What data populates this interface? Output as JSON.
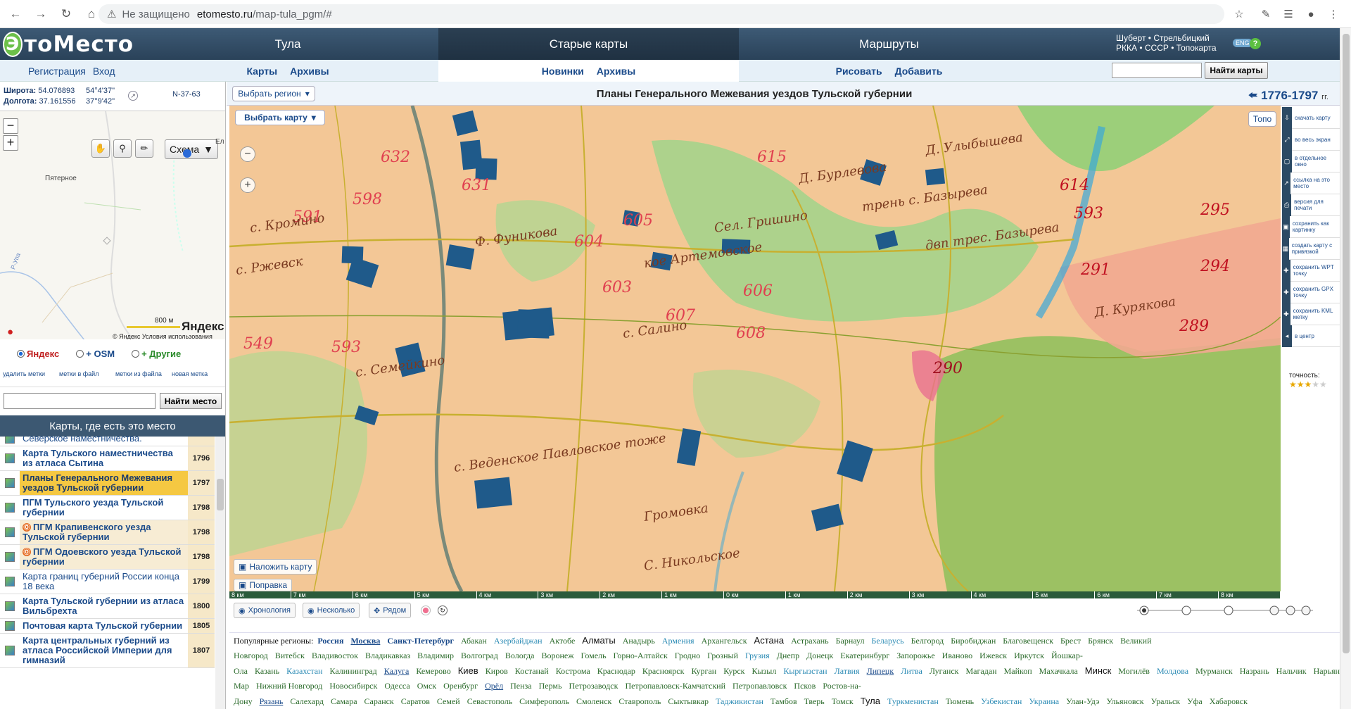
{
  "browser": {
    "security_label": "Не защищено",
    "url_domain": "etomesto.ru",
    "url_path": "/map-tula_pgm/#"
  },
  "header": {
    "logo": "ЭтоМесто",
    "sections": [
      "Тула",
      "Старые карты",
      "Маршруты"
    ],
    "right_line1": "Шуберт • Стрельбицкий",
    "right_line2": "РККА • СССР • Топокарта",
    "lang_badge": "ENG",
    "help": "?"
  },
  "subnav": {
    "auth": [
      "Регистрация",
      "Вход"
    ],
    "sec1": [
      "Карты",
      "Архивы"
    ],
    "sec2": [
      "Новинки",
      "Архивы"
    ],
    "sec3": [
      "Рисовать",
      "Добавить"
    ],
    "find_map_button": "Найти карты"
  },
  "coords": {
    "lat_label": "Широта:",
    "lat_value": "54.076893",
    "lat_dms": "54°4'37\"",
    "lon_label": "Долгота:",
    "lon_value": "37.161556",
    "lon_dms": "37°9'42\"",
    "sheet": "N-37-63"
  },
  "minimap": {
    "scheme_label": "Схема",
    "place_label": "Пятерное",
    "place_edge": "Ел",
    "road_label": "Р-Упа",
    "scale_label": "800 м",
    "yandex_logo": "Яндекс",
    "copyright": "© Яндекс",
    "terms": "Условия использования"
  },
  "providers": [
    "Яндекс",
    "+ OSM",
    "+ Другие"
  ],
  "mark_buttons": [
    "удалить метки",
    "метки в файл",
    "метки из файла",
    "новая метка"
  ],
  "find_place_button": "Найти место",
  "maps_list": {
    "header": "Карты, где есть это место",
    "rows": [
      {
        "title": "Северское наместничества.",
        "year": "",
        "style": "norm"
      },
      {
        "title": "Карта Тульского наместничества из атласа Сытина",
        "year": "1796",
        "style": "bold"
      },
      {
        "title": "Планы Генерального Межевания уездов Тульской губернии",
        "year": "1797",
        "style": "sel"
      },
      {
        "title": "ПГМ Тульского уезда Тульской губернии",
        "year": "1798",
        "style": "bold"
      },
      {
        "title": "ПГМ Крапивенского уезда Тульской губернии",
        "year": "1798",
        "style": "alt",
        "old": true
      },
      {
        "title": "ПГМ Одоевского уезда Тульской губернии",
        "year": "1798",
        "style": "alt",
        "old": true
      },
      {
        "title": "Карта границ губерний России конца 18 века",
        "year": "1799",
        "style": "norm"
      },
      {
        "title": "Карта Тульской губернии из атласа Вильбрехта",
        "year": "1800",
        "style": "bold"
      },
      {
        "title": "Почтовая карта Тульской губернии",
        "year": "1805",
        "style": "bold"
      },
      {
        "title": "Карта центральных губерний из атласа Российской Империи для гимназий",
        "year": "1807",
        "style": "bold"
      }
    ]
  },
  "map": {
    "region_button": "Выбрать регион",
    "title": "Планы Генерального Межевания уездов Тульской губернии",
    "years": "1776-1797",
    "years_suffix": "гг.",
    "choose_map_button": "Выбрать карту",
    "topo_button": "Топо",
    "overlay_button": "Наложить карту",
    "correction_button": "Поправка",
    "scale_ticks": [
      "8 км",
      "7 км",
      "6 км",
      "5 км",
      "4 км",
      "3 км",
      "2 км",
      "1 км",
      "0 км",
      "1 км",
      "2 км",
      "3 км",
      "4 км",
      "5 км",
      "6 км",
      "7 км",
      "8 км"
    ],
    "bottom_tools": [
      "Хронология",
      "Несколько",
      "Рядом"
    ],
    "labels": [
      "591",
      "593",
      "605",
      "603",
      "604",
      "606",
      "607",
      "608",
      "615",
      "614",
      "593",
      "295",
      "291",
      "294",
      "289",
      "290",
      "632",
      "631",
      "549",
      "598",
      "с. Кромино",
      "Ф. Фуникова",
      "кое Артемовское",
      "Сел. Гришино",
      "трень с. Базырева",
      "двп трес. Базырева",
      "с. Салино",
      "с. Семейкино",
      "Громовка",
      "с. Веденское Павловское тоже",
      "С. Никольское",
      "Д. Бурлевова",
      "Д. Улыбышева",
      "с. Ржевск",
      "Д. Курякова"
    ]
  },
  "right_tools": [
    "скачать карту",
    "во весь экран",
    "в отдельное окно",
    "ссылка на это место",
    "версия для печати",
    "сохранить как картинку",
    "создать карту с привязкой",
    "сохранить WPT точку",
    "сохранить GPX точку",
    "сохранить KML метку",
    "в центр"
  ],
  "accuracy_label": "точность:",
  "accuracy_stars": 3,
  "regions": {
    "label": "Популярные регионы:",
    "items": [
      {
        "n": "Россия",
        "s": "b"
      },
      {
        "n": "Москва",
        "s": "bu"
      },
      {
        "n": "Санкт-Петербург",
        "s": "b"
      },
      {
        "n": "Абакан",
        "s": "g"
      },
      {
        "n": "Азербайджан",
        "s": "t"
      },
      {
        "n": "Актобе",
        "s": "g"
      },
      {
        "n": "Алматы",
        "s": "bk"
      },
      {
        "n": "Анадырь",
        "s": "g"
      },
      {
        "n": "Армения",
        "s": "t"
      },
      {
        "n": "Архангельск",
        "s": "g"
      },
      {
        "n": "Астана",
        "s": "bk"
      },
      {
        "n": "Астрахань",
        "s": "g"
      },
      {
        "n": "Барнаул",
        "s": "g"
      },
      {
        "n": "Беларусь",
        "s": "t"
      },
      {
        "n": "Белгород",
        "s": "g"
      },
      {
        "n": "Биробиджан",
        "s": "g"
      },
      {
        "n": "Благовещенск",
        "s": "g"
      },
      {
        "n": "Брест",
        "s": "g"
      },
      {
        "n": "Брянск",
        "s": "g"
      },
      {
        "n": "Великий Новгород",
        "s": "g"
      },
      {
        "n": "Витебск",
        "s": "g"
      },
      {
        "n": "Владивосток",
        "s": "g"
      },
      {
        "n": "Владикавказ",
        "s": "g"
      },
      {
        "n": "Владимир",
        "s": "g"
      },
      {
        "n": "Волгоград",
        "s": "g"
      },
      {
        "n": "Вологда",
        "s": "g"
      },
      {
        "n": "Воронеж",
        "s": "g"
      },
      {
        "n": "Гомель",
        "s": "g"
      },
      {
        "n": "Горно-Алтайск",
        "s": "g"
      },
      {
        "n": "Гродно",
        "s": "g"
      },
      {
        "n": "Грозный",
        "s": "g"
      },
      {
        "n": "Грузия",
        "s": "t"
      },
      {
        "n": "Днепр",
        "s": "g"
      },
      {
        "n": "Донецк",
        "s": "g"
      },
      {
        "n": "Екатеринбург",
        "s": "g"
      },
      {
        "n": "Запорожье",
        "s": "g"
      },
      {
        "n": "Иваново",
        "s": "g"
      },
      {
        "n": "Ижевск",
        "s": "g"
      },
      {
        "n": "Иркутск",
        "s": "g"
      },
      {
        "n": "Йошкар-Ола",
        "s": "g"
      },
      {
        "n": "Казань",
        "s": "g"
      },
      {
        "n": "Казахстан",
        "s": "t"
      },
      {
        "n": "Калининград",
        "s": "g"
      },
      {
        "n": "Калуга",
        "s": "u"
      },
      {
        "n": "Кемерово",
        "s": "g"
      },
      {
        "n": "Киев",
        "s": "bk"
      },
      {
        "n": "Киров",
        "s": "g"
      },
      {
        "n": "Костанай",
        "s": "g"
      },
      {
        "n": "Кострома",
        "s": "g"
      },
      {
        "n": "Краснодар",
        "s": "g"
      },
      {
        "n": "Красноярск",
        "s": "g"
      },
      {
        "n": "Курган",
        "s": "g"
      },
      {
        "n": "Курск",
        "s": "g"
      },
      {
        "n": "Кызыл",
        "s": "g"
      },
      {
        "n": "Кыргызстан",
        "s": "t"
      },
      {
        "n": "Латвия",
        "s": "t"
      },
      {
        "n": "Липецк",
        "s": "u"
      },
      {
        "n": "Литва",
        "s": "t"
      },
      {
        "n": "Луганск",
        "s": "g"
      },
      {
        "n": "Магадан",
        "s": "g"
      },
      {
        "n": "Майкоп",
        "s": "g"
      },
      {
        "n": "Махачкала",
        "s": "g"
      },
      {
        "n": "Минск",
        "s": "bk"
      },
      {
        "n": "Могилёв",
        "s": "g"
      },
      {
        "n": "Молдова",
        "s": "t"
      },
      {
        "n": "Мурманск",
        "s": "g"
      },
      {
        "n": "Назрань",
        "s": "g"
      },
      {
        "n": "Нальчик",
        "s": "g"
      },
      {
        "n": "Нарьян-Мар",
        "s": "g"
      },
      {
        "n": "Нижний Новгород",
        "s": "g"
      },
      {
        "n": "Новосибирск",
        "s": "g"
      },
      {
        "n": "Одесса",
        "s": "g"
      },
      {
        "n": "Омск",
        "s": "g"
      },
      {
        "n": "Оренбург",
        "s": "g"
      },
      {
        "n": "Орёл",
        "s": "u"
      },
      {
        "n": "Пенза",
        "s": "g"
      },
      {
        "n": "Пермь",
        "s": "g"
      },
      {
        "n": "Петрозаводск",
        "s": "g"
      },
      {
        "n": "Петропавловск-Камчатский",
        "s": "g"
      },
      {
        "n": "Петропавловск",
        "s": "g"
      },
      {
        "n": "Псков",
        "s": "g"
      },
      {
        "n": "Ростов-на-Дону",
        "s": "g"
      },
      {
        "n": "Рязань",
        "s": "u"
      },
      {
        "n": "Салехард",
        "s": "g"
      },
      {
        "n": "Самара",
        "s": "g"
      },
      {
        "n": "Саранск",
        "s": "g"
      },
      {
        "n": "Саратов",
        "s": "g"
      },
      {
        "n": "Семей",
        "s": "g"
      },
      {
        "n": "Севастополь",
        "s": "g"
      },
      {
        "n": "Симферополь",
        "s": "g"
      },
      {
        "n": "Смоленск",
        "s": "g"
      },
      {
        "n": "Ставрополь",
        "s": "g"
      },
      {
        "n": "Сыктывкар",
        "s": "g"
      },
      {
        "n": "Таджикистан",
        "s": "t"
      },
      {
        "n": "Тамбов",
        "s": "g"
      },
      {
        "n": "Тверь",
        "s": "g"
      },
      {
        "n": "Томск",
        "s": "g"
      },
      {
        "n": "Тула",
        "s": "bk"
      },
      {
        "n": "Туркменистан",
        "s": "t"
      },
      {
        "n": "Тюмень",
        "s": "g"
      },
      {
        "n": "Узбекистан",
        "s": "t"
      },
      {
        "n": "Украина",
        "s": "t"
      },
      {
        "n": "Улан-Удэ",
        "s": "g"
      },
      {
        "n": "Ульяновск",
        "s": "g"
      },
      {
        "n": "Уральск",
        "s": "g"
      },
      {
        "n": "Уфа",
        "s": "g"
      },
      {
        "n": "Хабаровск",
        "s": "g"
      }
    ]
  }
}
